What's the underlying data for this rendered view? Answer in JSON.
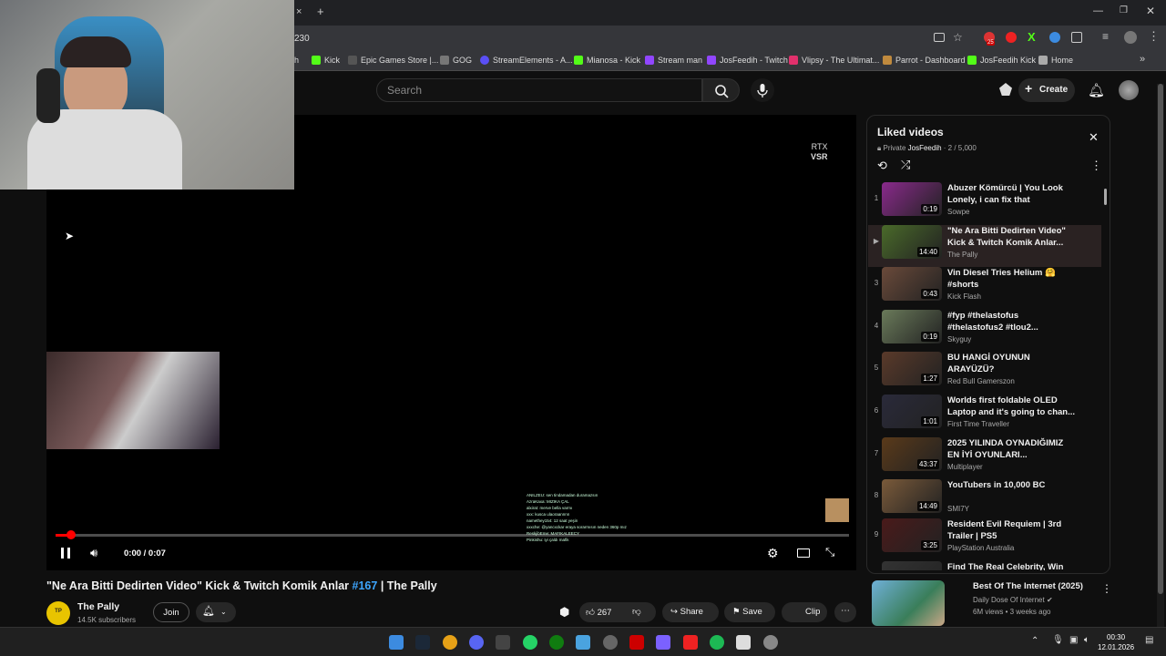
{
  "browser": {
    "url_fragment": "230",
    "tab_close": "×",
    "new_tab": "+",
    "bookmarks": [
      {
        "label": "h",
        "color": "#888"
      },
      {
        "label": "Kick",
        "color": "#53fc18"
      },
      {
        "label": "Epic Games Store |...",
        "color": "#ddd"
      },
      {
        "label": "GOG",
        "color": "#aaa"
      },
      {
        "label": "StreamElements - A...",
        "color": "#5a4ff5"
      },
      {
        "label": "Mianosa - Kick",
        "color": "#53fc18"
      },
      {
        "label": "Stream man",
        "color": "#9146ff"
      },
      {
        "label": "JosFeedih - Twitch",
        "color": "#9146ff"
      },
      {
        "label": "Vlipsy - The Ultimat...",
        "color": "#e1306c"
      },
      {
        "label": "Parrot - Dashboard",
        "color": "#c08a3e"
      },
      {
        "label": "JosFeedih Kick",
        "color": "#53fc18"
      },
      {
        "label": "Home",
        "color": "#ddd"
      }
    ],
    "badge_count": "25"
  },
  "header": {
    "search_placeholder": "Search",
    "create_label": "Create"
  },
  "player": {
    "overlay_rtx": "RTX",
    "overlay_vsr": "VSR",
    "time": "0:00 / 0:07",
    "progress_fraction": 0.02
  },
  "video": {
    "title_prefix": "\"Ne Ara Bitti Dedirten Video\" Kick & Twitch Komik Anlar ",
    "hashtag": "#167",
    "title_suffix": " | The Pally",
    "channel": "The Pally",
    "subscribers": "14.5K subscribers",
    "join_label": "Join",
    "likes": "267",
    "share_label": "Share",
    "save_label": "Save",
    "clip_label": "Clip"
  },
  "playlist": {
    "title": "Liked videos",
    "privacy": "Private",
    "owner": "JosFeedih",
    "count": "2 / 5,000",
    "items": [
      {
        "idx": "1",
        "title": "Abuzer Kömürcü | You Look Lonely, i can fix that",
        "channel": "Sowpe",
        "duration": "0:19",
        "color": "#8a2a8c"
      },
      {
        "idx": "▶",
        "title": "\"Ne Ara Bitti Dedirten Video\" Kick & Twitch Komik Anlar...",
        "channel": "The Pally",
        "duration": "14:40",
        "color": "#4a6a2a"
      },
      {
        "idx": "3",
        "title": "Vin Diesel Tries Helium 🤗 #shorts",
        "channel": "Kick Flash",
        "duration": "0:43",
        "color": "#6a4a3a"
      },
      {
        "idx": "4",
        "title": "#fyp #thelastofus #thelastofus2 #tlou2...",
        "channel": "Skyguy",
        "duration": "0:19",
        "color": "#6a7a5a"
      },
      {
        "idx": "5",
        "title": "BU HANGİ OYUNUN ARAYÜZÜ? @EnisKirazogluvideolar",
        "channel": "Red Bull Gamerszon",
        "duration": "1:27",
        "color": "#5a3a2a"
      },
      {
        "idx": "6",
        "title": "Worlds first foldable OLED Laptop and it's going to chan...",
        "channel": "First Time Traveller",
        "duration": "1:01",
        "color": "#2a2a3a"
      },
      {
        "idx": "7",
        "title": "2025 YILINDA OYNADIĞIMIZ EN İYİ OYUNLARI...",
        "channel": "Multiplayer",
        "duration": "43:37",
        "color": "#5a3a1a"
      },
      {
        "idx": "8",
        "title": "YouTubers in 10,000 BC",
        "channel": "SMI7Y",
        "duration": "14:49",
        "color": "#7a5a3a"
      },
      {
        "idx": "9",
        "title": "Resident Evil Requiem | 3rd Trailer | PS5",
        "channel": "PlayStation Australia",
        "duration": "3:25",
        "color": "#4a1a1a"
      },
      {
        "idx": "",
        "title": "Find The Real Celebrity, Win",
        "channel": "",
        "duration": "",
        "color": "#333"
      }
    ]
  },
  "recommendation": {
    "title": "Best Of The Internet (2025)",
    "channel": "Daily Dose Of Internet",
    "meta": "6M views • 3 weeks ago"
  },
  "chat_lines": [
    "ANILZEU: sen tindamadan duramazsın",
    "AzraKaxa: MIZIKA ÇAL",
    "alxirat: merve bella varmı",
    "xxx: kusca ulaoraannnn",
    "namethey154: 12 saat yeşin",
    "xxxche: @yancxckar eraya sorarmısın neden 360p mız",
    "ReskjibEme: MAFIKALEECY",
    "Pinkishu: iyi çaldı mafik"
  ],
  "taskbar": {
    "time": "00:30",
    "date": "12.01.2026"
  }
}
